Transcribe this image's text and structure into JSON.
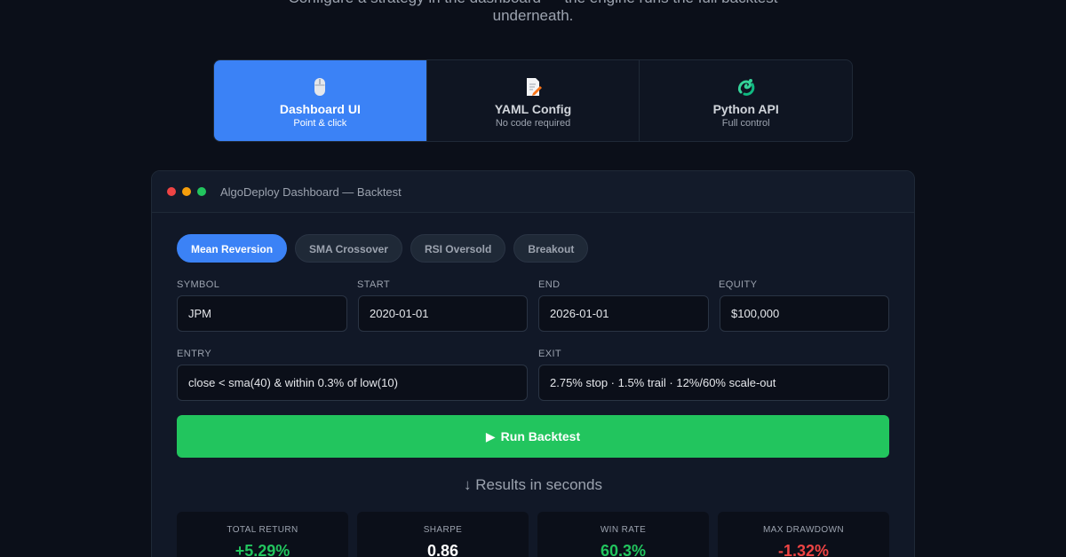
{
  "intro": {
    "line1": "Configure a strategy in the dashboard — the engine runs the full backtest",
    "line2": "underneath."
  },
  "modes": [
    {
      "title": "Dashboard UI",
      "subtitle": "Point & click",
      "icon": "mouse-icon",
      "active": true
    },
    {
      "title": "YAML Config",
      "subtitle": "No code required",
      "icon": "document-pencil-icon",
      "active": false
    },
    {
      "title": "Python API",
      "subtitle": "Full control",
      "icon": "python-snake-icon",
      "active": false
    }
  ],
  "window": {
    "title": "AlgoDeploy Dashboard — Backtest"
  },
  "tabs": [
    "Mean Reversion",
    "SMA Crossover",
    "RSI Oversold",
    "Breakout"
  ],
  "form": {
    "symbol_label": "SYMBOL",
    "symbol_value": "JPM",
    "start_label": "START",
    "start_value": "2020-01-01",
    "end_label": "END",
    "end_value": "2026-01-01",
    "equity_label": "EQUITY",
    "equity_value": "$100,000",
    "entry_label": "ENTRY",
    "entry_value": "close < sma(40) & within 0.3% of low(10)",
    "exit_label": "EXIT",
    "exit_value": "2.75% stop · 1.5% trail · 12%/60% scale-out"
  },
  "run_button": "Run Backtest",
  "results_caption": "↓ Results in seconds",
  "metrics": [
    {
      "label": "TOTAL RETURN",
      "value": "+5.29%"
    },
    {
      "label": "SHARPE",
      "value": "0.86"
    },
    {
      "label": "WIN RATE",
      "value": "60.3%"
    },
    {
      "label": "MAX DRAWDOWN",
      "value": "-1.32%"
    }
  ],
  "colors": {
    "accent": "#3b82f6",
    "success": "#22c55e",
    "danger": "#ef4444",
    "background": "#0b0f19"
  }
}
